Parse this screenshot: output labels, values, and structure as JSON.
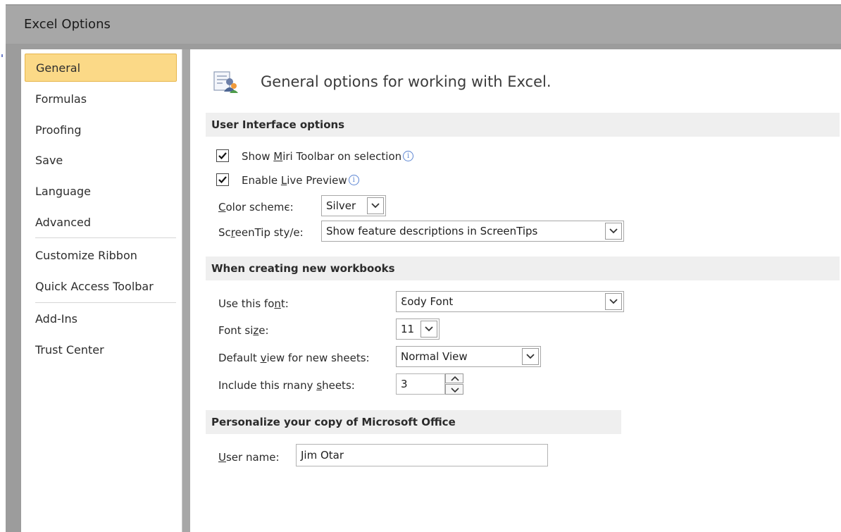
{
  "window": {
    "title": "Excel Options"
  },
  "sidebar": {
    "items": [
      {
        "label": "General"
      },
      {
        "label": "Formulas"
      },
      {
        "label": "Proofing"
      },
      {
        "label": "Save"
      },
      {
        "label": "Language"
      },
      {
        "label": "Advanced"
      },
      {
        "label": "Customize Ribbon"
      },
      {
        "label": "Quick Access Toolbar"
      },
      {
        "label": "Add-Ins"
      },
      {
        "label": "Trust Center"
      }
    ],
    "selected": "General"
  },
  "main": {
    "heading": "General options for working with Excel.",
    "sections": {
      "ui": {
        "title": "User Interface options",
        "mini_toolbar": {
          "label_pre": "Show ",
          "label_key": "M",
          "label_post": "iri Toolbar on selection",
          "checked": true
        },
        "live_preview": {
          "label_pre": "Enable ",
          "label_key": "L",
          "label_post": "ive Preview",
          "checked": true
        },
        "color_scheme": {
          "label_key": "C",
          "label_post": "olor schemє:",
          "value": "Silver"
        },
        "screentip": {
          "label_pre": "Sc",
          "label_key": "r",
          "label_post": "eenTip sty/e:",
          "value": "Show feature descriptions in ScreenTips"
        }
      },
      "workbooks": {
        "title": "When creating new workbooks",
        "font": {
          "label_pre": "Use this fo",
          "label_key": "n",
          "label_post": "t:",
          "value": "Ɛody Font"
        },
        "font_size": {
          "label_pre": "Font si",
          "label_key": "z",
          "label_post": "e:",
          "value": "11"
        },
        "default_view": {
          "label_pre": "Default ",
          "label_key": "v",
          "label_post": "iew for new sheets:",
          "value": "Normal View"
        },
        "sheets": {
          "label_pre": "Include this rnany ",
          "label_key": "s",
          "label_post": "heets:",
          "value": "3"
        }
      },
      "personalize": {
        "title": "Personalize your copy of Microsoft Office",
        "user_name": {
          "label_key": "U",
          "label_post": "ser name:",
          "value": "Jim Otar"
        }
      }
    }
  },
  "icons": {
    "page_icon": "general-options-icon",
    "info": "info-icon",
    "dropdown": "chevron-down-icon",
    "spin_up": "chevron-up-icon",
    "check": "checkmark-icon"
  },
  "colors": {
    "selected_nav_bg": "#fbd987",
    "selected_nav_border": "#e7b54a",
    "section_bg": "#efefef",
    "titlebar": "#a7a7a7"
  }
}
